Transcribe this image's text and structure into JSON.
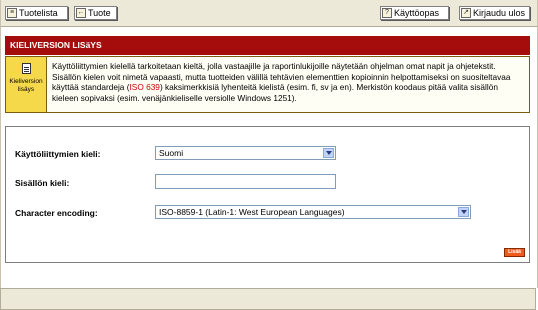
{
  "toolbar": {
    "product_list_label": "Tuotelista",
    "product_label": "Tuote",
    "user_guide_label": "Käyttöopas",
    "logout_label": "Kirjaudu ulos"
  },
  "header": {
    "title": "KIELIVERSION LISäYS"
  },
  "info": {
    "side_label": "Kieliversion lisäys",
    "text_part1": "Käyttöliittymien kielellä tarkoitetaan kieltä, jolla vastaajille ja raportinlukijoille näytetään ohjelman omat napit ja ohjetekstit. Sisällön kielen voit nimetä vapaasti, mutta tuotteiden välillä tehtävien elementtien kopioinnin helpottamiseksi on suositeltavaa käyttää standardeja (",
    "iso_link": "ISO 639",
    "text_part2": ") kaksimerkkisiä lyhenteitä kielistä (esim. fi, sv ja en). Merkistön koodaus pitää valita sisällön kieleen sopivaksi (esim. venäjänkieliselle versiolle Windows 1251)."
  },
  "form": {
    "ui_language_label": "Käyttöliittymien kieli:",
    "ui_language_value": "Suomi",
    "content_language_label": "Sisällön kieli:",
    "content_language_value": "",
    "encoding_label": "Character encoding:",
    "encoding_value": "ISO-8859-1 (Latin-1: West European Languages)",
    "add_button_label": "Lisää"
  },
  "colors": {
    "header_bg": "#a50d0d",
    "info_side_bg": "#f6d94a",
    "add_button_bg": "#f15a1d"
  }
}
